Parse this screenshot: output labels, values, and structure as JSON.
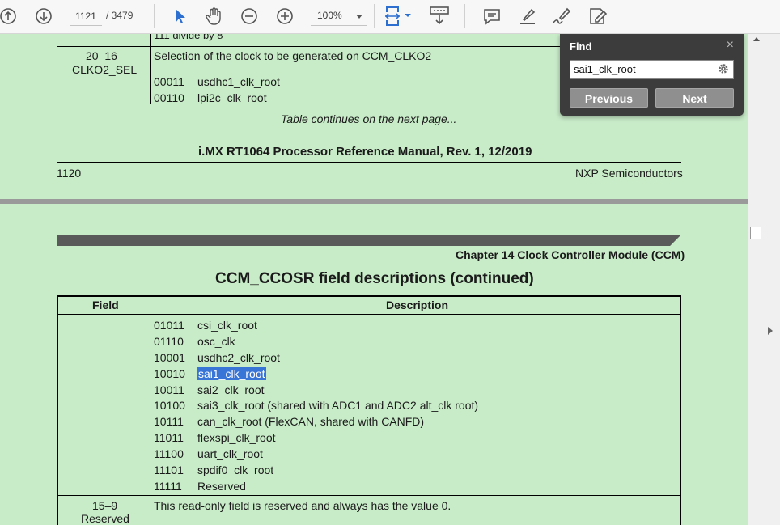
{
  "toolbar": {
    "page_current": "1121",
    "page_total": "/ 3479",
    "zoom": "100%",
    "icons": [
      "up-arrow-icon",
      "down-arrow-icon",
      "select-arrow-icon",
      "hand-icon",
      "zoom-out-icon",
      "zoom-in-icon",
      "fit-page-icon",
      "scroll-mode-icon",
      "comment-icon",
      "highlight-icon",
      "sign-icon",
      "edit-icon"
    ]
  },
  "page1": {
    "top_row": "111    divide by 8",
    "row_field_num": "20–16",
    "row_field_name": "CLKO2_SEL",
    "row_desc": "Selection of the clock to be generated on CCM_CLKO2",
    "codes": [
      {
        "code": "00011",
        "label": "usdhc1_clk_root"
      },
      {
        "code": "00110",
        "label": "lpi2c_clk_root"
      }
    ],
    "continues": "Table continues on the next page...",
    "footer_title": "i.MX RT1064 Processor Reference Manual, Rev. 1, 12/2019",
    "page_number": "1120",
    "company": "NXP Semiconductors"
  },
  "page2": {
    "chapter": "Chapter 14 Clock Controller Module (CCM)",
    "table_title": "CCM_CCOSR field descriptions (continued)",
    "col_field": "Field",
    "col_desc": "Description",
    "codes": [
      {
        "code": "01011",
        "label": "csi_clk_root"
      },
      {
        "code": "01110",
        "label": "osc_clk"
      },
      {
        "code": "10001",
        "label": "usdhc2_clk_root"
      },
      {
        "code": "10010",
        "label": "sai1_clk_root"
      },
      {
        "code": "10011",
        "label": "sai2_clk_root"
      },
      {
        "code": "10100",
        "label": "sai3_clk_root (shared with ADC1 and ADC2 alt_clk root)"
      },
      {
        "code": "10111",
        "label": "can_clk_root (FlexCAN, shared with CANFD)"
      },
      {
        "code": "11011",
        "label": "flexspi_clk_root"
      },
      {
        "code": "11100",
        "label": "uart_clk_root"
      },
      {
        "code": "11101",
        "label": "spdif0_clk_root"
      },
      {
        "code": "11111",
        "label": "Reserved"
      }
    ],
    "last_field_num": "15–9",
    "last_field_name": "Reserved",
    "last_desc": "This read-only field is reserved and always has the value 0."
  },
  "find": {
    "title": "Find",
    "close": "×",
    "query": "sai1_clk_root",
    "previous": "Previous",
    "next": "Next"
  },
  "colors": {
    "page_bg": "#c8ebc8",
    "highlight": "#3875d7",
    "toolbar_blue": "#2d6fd1",
    "find_panel": "#3c3c3c"
  }
}
